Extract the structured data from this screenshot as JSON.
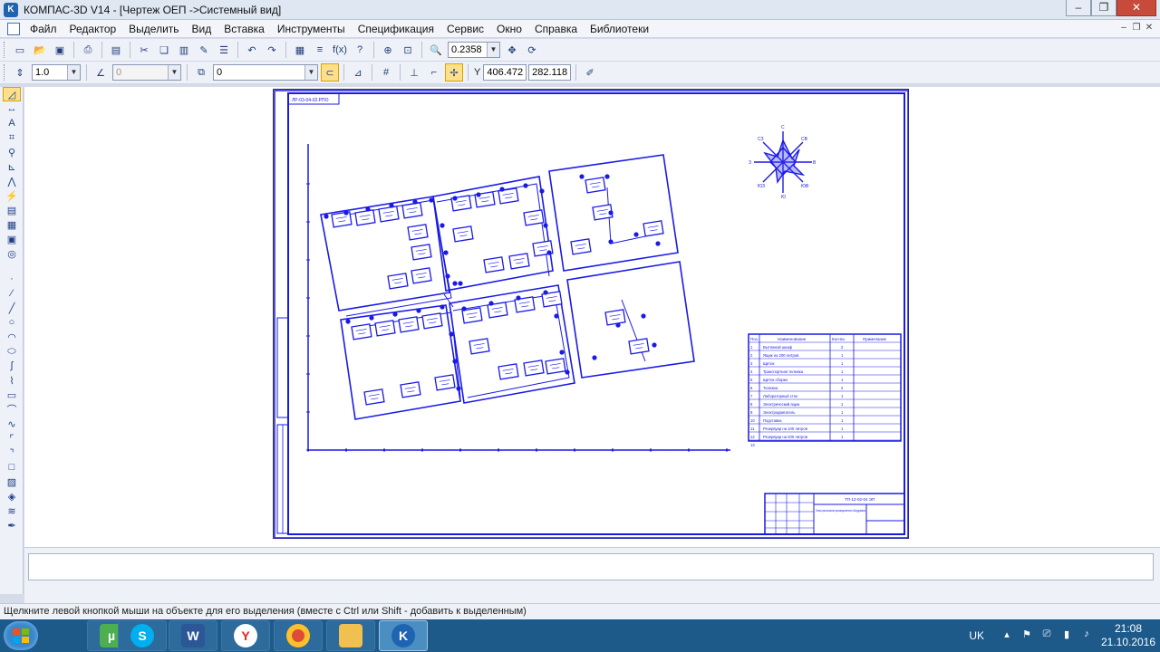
{
  "window": {
    "title": "КОМПАС-3D V14 - [Чертеж ОЕП ->Системный вид]",
    "app_icon": "kompas-logo-icon"
  },
  "menu": [
    "Файл",
    "Редактор",
    "Выделить",
    "Вид",
    "Вставка",
    "Инструменты",
    "Спецификация",
    "Сервис",
    "Окно",
    "Справка",
    "Библиотеки"
  ],
  "toolbar1": {
    "zoom_value": "0.2358"
  },
  "toolbar2": {
    "step_value": "1.0",
    "angle_value": "0",
    "layer_value": "0",
    "coord_x": "406.472",
    "coord_y": "282.118",
    "coord_label": "Y"
  },
  "drawing": {
    "stamp_box": "ЛР-03-04-02.РПО",
    "title_code": "ТП-12-02-04 ЭП",
    "title_name": "Планы расположения производственного оборудования",
    "north_labels": [
      "С",
      "СВ",
      "В",
      "ЮВ",
      "Ю",
      "ЮЗ",
      "З",
      "СЗ"
    ],
    "spec_headers": [
      "Поз.",
      "Наименование",
      "Кол-во",
      "Примечание"
    ],
    "spec_rows": [
      [
        "1",
        "Вытяжной шкаф",
        "2",
        ""
      ],
      [
        "2",
        "Ящик на 200 литров",
        "1",
        ""
      ],
      [
        "3",
        "Щиток",
        "1",
        ""
      ],
      [
        "4",
        "Транспортная тележка",
        "1",
        ""
      ],
      [
        "5",
        "Щиток сборки",
        "1",
        ""
      ],
      [
        "6",
        "Тележка",
        "2",
        ""
      ],
      [
        "7",
        "Лабораторный стол",
        "1",
        ""
      ],
      [
        "8",
        "Электрический ящик",
        "1",
        ""
      ],
      [
        "9",
        "Электродвигатель",
        "1",
        ""
      ],
      [
        "10",
        "Подставка",
        "1",
        ""
      ],
      [
        "11",
        "Резервуар на 100 литров",
        "1",
        ""
      ],
      [
        "12",
        "Резервуар на 200 литров",
        "1",
        ""
      ],
      [
        "13",
        "",
        "",
        ""
      ]
    ]
  },
  "status": {
    "hint": "Щелкните левой кнопкой мыши на объекте для его выделения (вместе с Ctrl или Shift - добавить к выделенным)"
  },
  "taskbar": {
    "language": "UK",
    "time": "21:08",
    "date": "21.10.2016"
  }
}
